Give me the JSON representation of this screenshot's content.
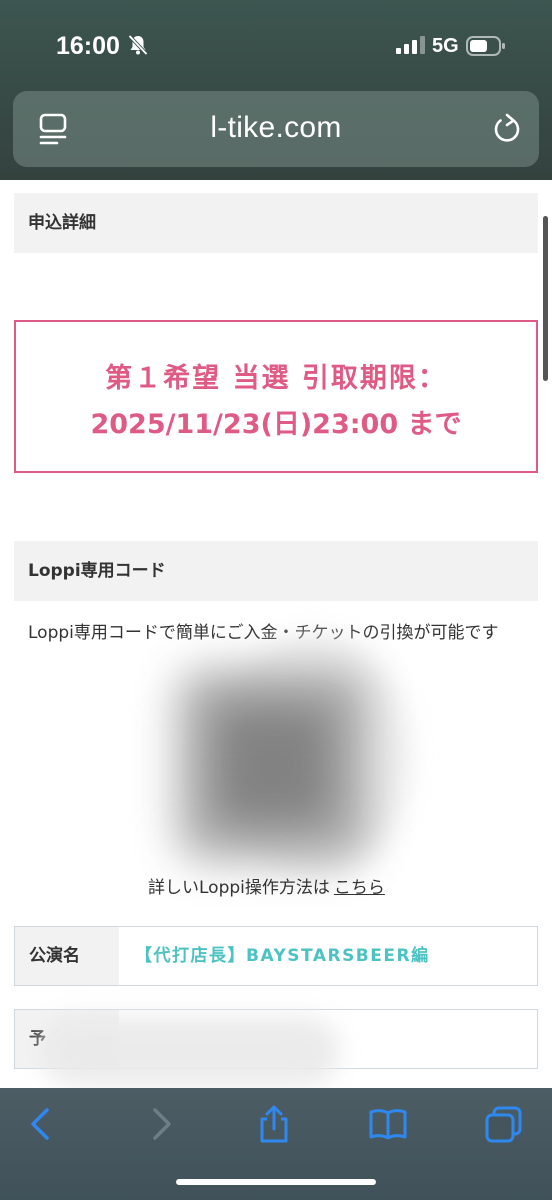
{
  "status_bar": {
    "time": "16:00",
    "network": "5G",
    "icons": [
      "bell-slash-icon",
      "signal-icon",
      "battery-icon"
    ]
  },
  "browser": {
    "url": "l-tike.com",
    "icons": [
      "reader-icon",
      "reload-icon"
    ]
  },
  "page": {
    "section1_title": "申込詳細",
    "deadline_line1": "第１希望 当選 引取期限：",
    "deadline_line2": "2025/11/23(日)23:00 まで",
    "section2_title": "Loppi専用コード",
    "loppi_description": "Loppi専用コードで簡単にご入金・チケットの引換が可能です",
    "howto_prefix": "詳しいLoppi操作方法は",
    "howto_link": "こちら",
    "table": {
      "row1_header": "公演名",
      "row1_value": "【代打店長】BAYSTARSBEER編",
      "row2_header": "予"
    }
  },
  "toolbar": {
    "icons": [
      "back-icon",
      "forward-icon",
      "share-icon",
      "bookmarks-icon",
      "tabs-icon"
    ]
  },
  "colors": {
    "accent_pink": "#e05a86",
    "link_teal": "#4cc3c2",
    "ios_blue": "#2f88f0"
  }
}
